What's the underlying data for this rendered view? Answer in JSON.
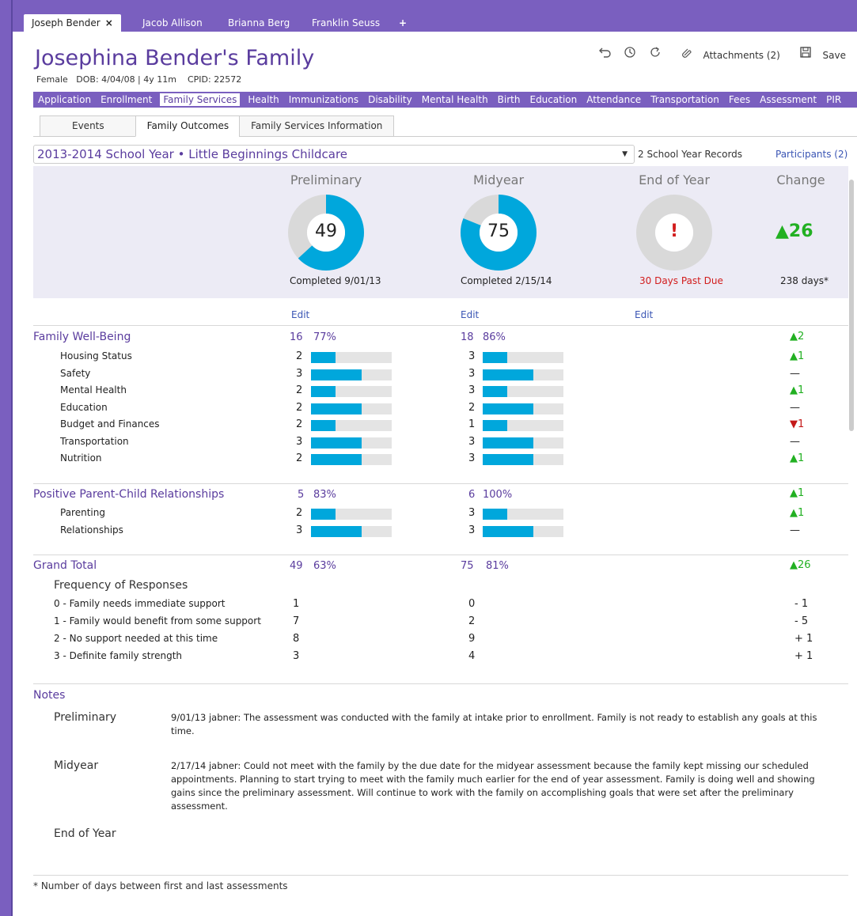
{
  "tabs": [
    {
      "label": "Joseph Bender",
      "close": "×",
      "active": true
    },
    {
      "label": "Jacob Allison",
      "active": false
    },
    {
      "label": "Brianna Berg",
      "active": false
    },
    {
      "label": "Franklin Seuss",
      "active": false
    }
  ],
  "add_tab": "+",
  "header": {
    "title": "Josephina Bender's Family",
    "gender": "Female",
    "dob": "DOB: 4/04/08 | 4y 11m",
    "cpid": "CPID: 22572"
  },
  "toolbar": {
    "attachments": "Attachments (2)",
    "save": "Save"
  },
  "topnav": [
    "Application",
    "Enrollment",
    "Family Services",
    "Health",
    "Immunizations",
    "Disability",
    "Mental Health",
    "Birth",
    "Education",
    "Attendance",
    "Transportation",
    "Fees",
    "Assessment",
    "PIR"
  ],
  "topnav_active": "Family Services",
  "subtabs": [
    {
      "label": "Events",
      "active": false
    },
    {
      "label": "Family Outcomes",
      "active": true
    },
    {
      "label": "Family Services Information",
      "active": false
    }
  ],
  "year": {
    "selected": "2013-2014 School Year • Little Beginnings Childcare",
    "records": "2 School Year Records",
    "participants": "Participants (2)"
  },
  "summary": {
    "preliminary": {
      "heading": "Preliminary",
      "score": "49",
      "fraction": 0.63,
      "status": "Completed  9/01/13"
    },
    "midyear": {
      "heading": "Midyear",
      "score": "75",
      "fraction": 0.81,
      "status": "Completed   2/15/14"
    },
    "end_of_year": {
      "heading": "End of Year",
      "score": "!",
      "fraction": 0,
      "status": "30 Days Past Due"
    },
    "change": {
      "heading": "Change",
      "value": "▲26",
      "days": "238 days*"
    }
  },
  "edit_label": "Edit",
  "sections": [
    {
      "title": "Family Well-Being",
      "prelim_score": "16",
      "prelim_pct": "77%",
      "mid_score": "18",
      "mid_pct": "86%",
      "change": "▲2",
      "change_dir": "up",
      "rows": [
        {
          "label": "Housing Status",
          "prelim": "2",
          "prelim_frac": 0.3,
          "mid": "3",
          "mid_frac": 0.3,
          "change": "▲1",
          "change_dir": "up"
        },
        {
          "label": "Safety",
          "prelim": "3",
          "prelim_frac": 0.63,
          "mid": "3",
          "mid_frac": 0.63,
          "change": "—",
          "change_dir": "flat"
        },
        {
          "label": "Mental Health",
          "prelim": "2",
          "prelim_frac": 0.3,
          "mid": "3",
          "mid_frac": 0.3,
          "change": "▲1",
          "change_dir": "up"
        },
        {
          "label": "Education",
          "prelim": "2",
          "prelim_frac": 0.63,
          "mid": "2",
          "mid_frac": 0.63,
          "change": "—",
          "change_dir": "flat"
        },
        {
          "label": "Budget and Finances",
          "prelim": "2",
          "prelim_frac": 0.3,
          "mid": "1",
          "mid_frac": 0.3,
          "change": "▼1",
          "change_dir": "down"
        },
        {
          "label": "Transportation",
          "prelim": "3",
          "prelim_frac": 0.63,
          "mid": "3",
          "mid_frac": 0.63,
          "change": "—",
          "change_dir": "flat"
        },
        {
          "label": "Nutrition",
          "prelim": "2",
          "prelim_frac": 0.63,
          "mid": "3",
          "mid_frac": 0.63,
          "change": "▲1",
          "change_dir": "up"
        }
      ]
    },
    {
      "title": "Positive Parent-Child Relationships",
      "prelim_score": "5",
      "prelim_pct": "83%",
      "mid_score": "6",
      "mid_pct": "100%",
      "change": "▲1",
      "change_dir": "up",
      "rows": [
        {
          "label": "Parenting",
          "prelim": "2",
          "prelim_frac": 0.3,
          "mid": "3",
          "mid_frac": 0.3,
          "change": "▲1",
          "change_dir": "up"
        },
        {
          "label": "Relationships",
          "prelim": "3",
          "prelim_frac": 0.63,
          "mid": "3",
          "mid_frac": 0.63,
          "change": "—",
          "change_dir": "flat"
        }
      ]
    }
  ],
  "grand_total": {
    "title": "Grand Total",
    "prelim_score": "49",
    "prelim_pct": "63%",
    "mid_score": "75",
    "mid_pct": "81%",
    "change": "▲26"
  },
  "frequency": {
    "title": "Frequency of Responses",
    "rows": [
      {
        "label": "0 - Family needs immediate support",
        "prelim": "1",
        "mid": "0",
        "change": "- 1"
      },
      {
        "label": "1 - Family would benefit from some support",
        "prelim": "7",
        "mid": "2",
        "change": "- 5"
      },
      {
        "label": "2 - No support needed at this time",
        "prelim": "8",
        "mid": "9",
        "change": "+ 1"
      },
      {
        "label": "3 - Definite family strength",
        "prelim": "3",
        "mid": "4",
        "change": "+ 1"
      }
    ]
  },
  "notes": {
    "title": "Notes",
    "items": [
      {
        "label": "Preliminary",
        "text": "9/01/13 jabner:  The assessment was conducted with the family at intake prior to enrollment.  Family is not ready to establish any goals at this time."
      },
      {
        "label": "Midyear",
        "text": "2/17/14 jabner:  Could not meet with the family by the due date for the midyear assessment because the family kept missing our scheduled appointments.  Planning to start trying to meet with the family much earlier for the end of year assessment.  Family is doing well and showing gains since the preliminary assessment.  Will continue to work with the family on accomplishing goals that were set after the preliminary assessment."
      },
      {
        "label": "End of Year",
        "text": ""
      }
    ]
  },
  "footnote": "* Number of days between first and last assessments",
  "colors": {
    "accent": "#7a5fbf",
    "title": "#5a3c9e",
    "bar": "#00a7dc",
    "up": "#22b022",
    "down": "#c41a1a"
  }
}
